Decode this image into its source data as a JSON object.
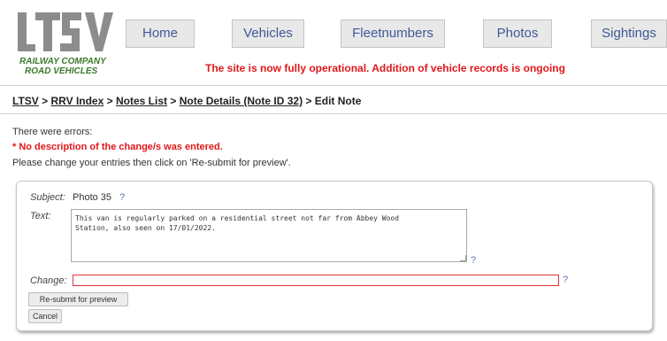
{
  "logo": {
    "letters": "LTSV",
    "line1": "RAILWAY COMPANY",
    "line2": "ROAD VEHICLES",
    "color": "#8c8c8c"
  },
  "nav": {
    "items": [
      {
        "label": "Home"
      },
      {
        "label": "Vehicles"
      },
      {
        "label": "Fleetnumbers"
      },
      {
        "label": "Photos"
      },
      {
        "label": "Sightings"
      }
    ]
  },
  "banner": "The site is now fully operational. Addition of vehicle records is ongoing",
  "breadcrumb": {
    "items": [
      "LTSV",
      "RRV Index",
      "Notes List",
      "Note Details (Note ID 32)"
    ],
    "separator": ">",
    "current": "Edit Note"
  },
  "errors": {
    "intro": "There were errors:",
    "message": "* No description of the change/s was entered.",
    "help": "Please change your entries then click on 'Re-submit for preview'."
  },
  "form": {
    "subject_label": "Subject:",
    "subject_value": "Photo 35",
    "help_mark": "?",
    "text_label": "Text:",
    "text_value": "This van is regularly parked on a residential street not far from Abbey Wood\nStation, also seen on 17/01/2022.",
    "change_label": "Change:",
    "change_value": "",
    "resubmit_label": "Re-submit for preview",
    "cancel_label": "Cancel"
  },
  "colors": {
    "accent": "#e0181b",
    "link": "#3d5a96",
    "brand_green": "#3c7a2a"
  }
}
